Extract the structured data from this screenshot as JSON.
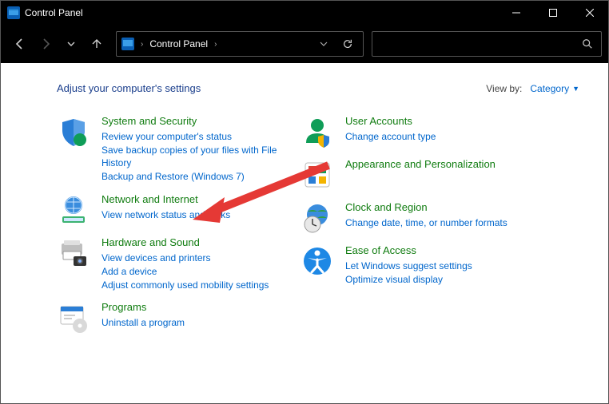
{
  "window": {
    "title": "Control Panel"
  },
  "breadcrumb": {
    "root": "Control Panel"
  },
  "header": {
    "page_title": "Adjust your computer's settings",
    "viewby_label": "View by:",
    "viewby_value": "Category"
  },
  "categories": {
    "system_security": {
      "title": "System and Security",
      "links": [
        "Review your computer's status",
        "Save backup copies of your files with File History",
        "Backup and Restore (Windows 7)"
      ]
    },
    "network_internet": {
      "title": "Network and Internet",
      "links": [
        "View network status and tasks"
      ]
    },
    "hardware_sound": {
      "title": "Hardware and Sound",
      "links": [
        "View devices and printers",
        "Add a device",
        "Adjust commonly used mobility settings"
      ]
    },
    "programs": {
      "title": "Programs",
      "links": [
        "Uninstall a program"
      ]
    },
    "user_accounts": {
      "title": "User Accounts",
      "links": [
        "Change account type"
      ]
    },
    "appearance": {
      "title": "Appearance and Personalization",
      "links": []
    },
    "clock_region": {
      "title": "Clock and Region",
      "links": [
        "Change date, time, or number formats"
      ]
    },
    "ease_access": {
      "title": "Ease of Access",
      "links": [
        "Let Windows suggest settings",
        "Optimize visual display"
      ]
    }
  }
}
